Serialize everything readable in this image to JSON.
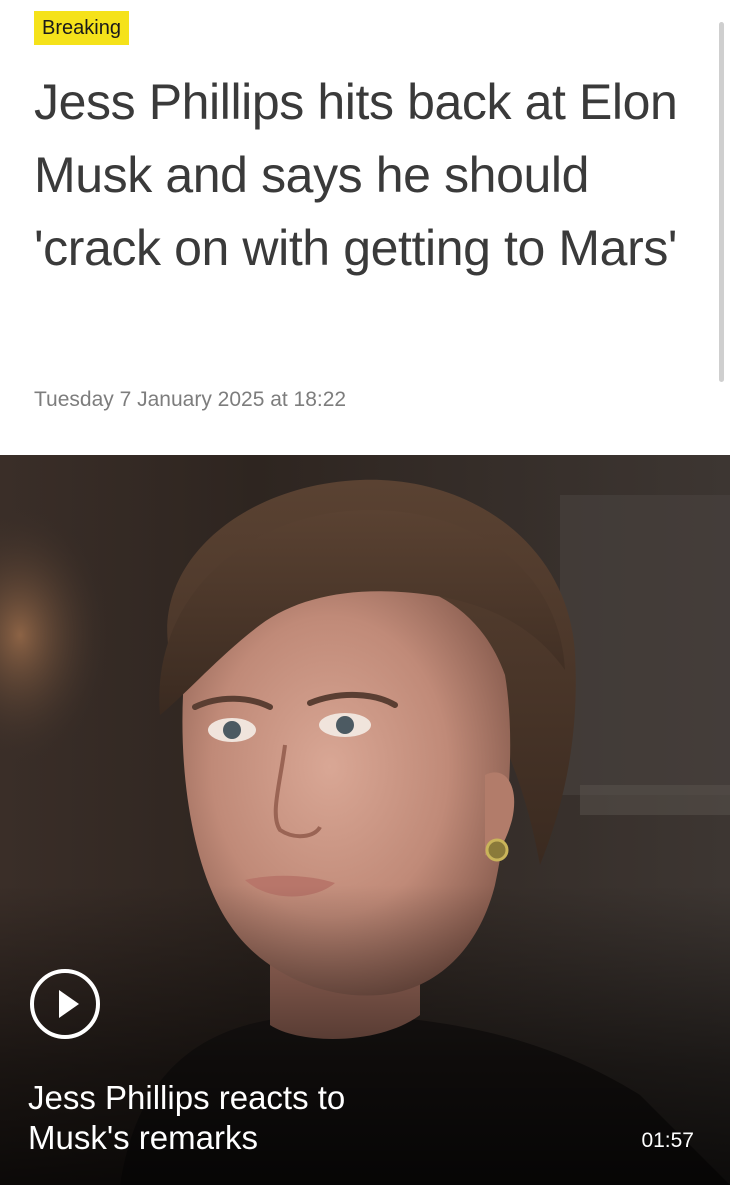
{
  "article": {
    "badge": "Breaking",
    "headline": "Jess Phillips hits back at Elon Musk and says he should 'crack on with getting to Mars'",
    "timestamp": "Tuesday 7 January 2025 at 18:22"
  },
  "video": {
    "caption": "Jess Phillips reacts to Musk's remarks",
    "duration": "01:57",
    "play_icon": "play-icon"
  },
  "colors": {
    "badge_background": "#f5e21a",
    "headline_text": "#3a3a3a",
    "timestamp_text": "#7d7d7d"
  }
}
